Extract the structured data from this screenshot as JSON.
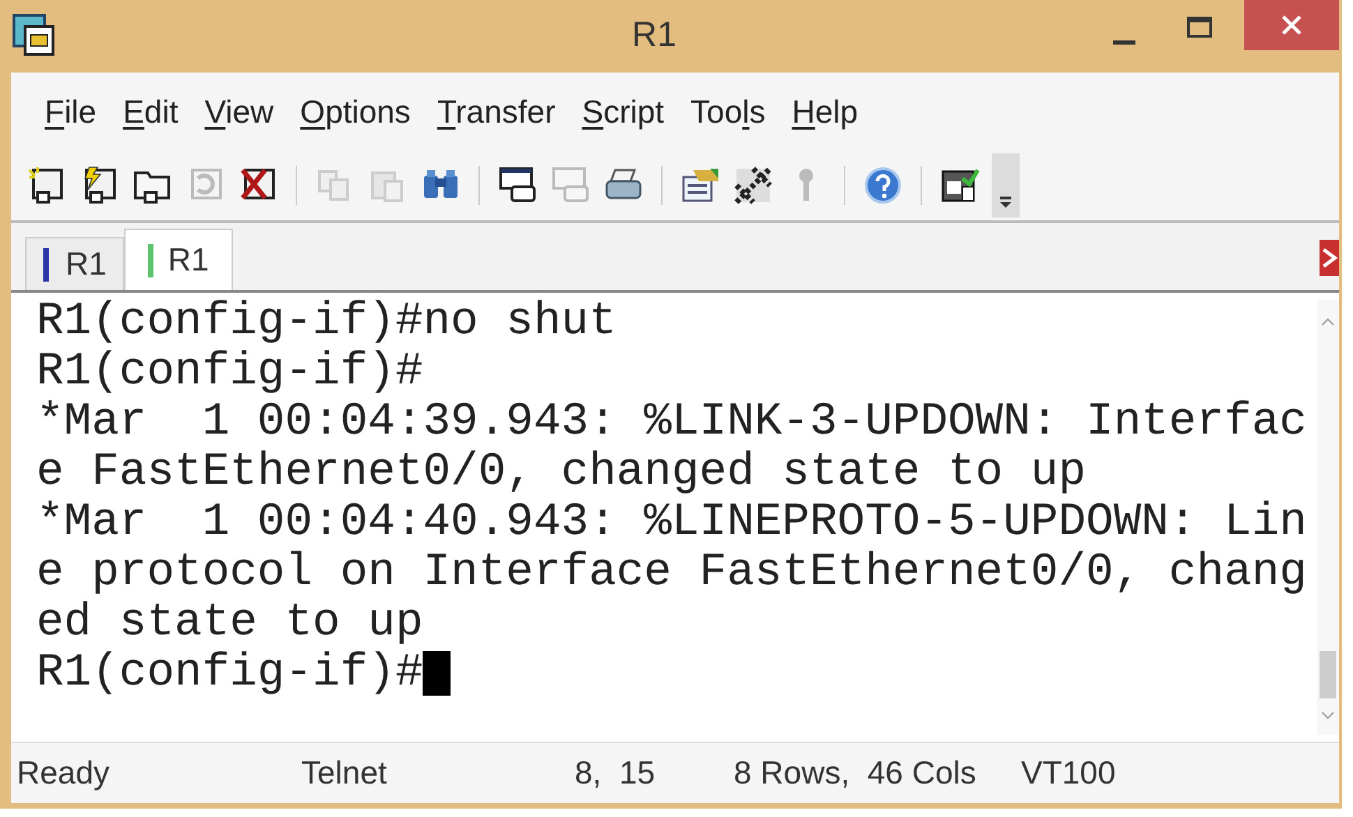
{
  "window": {
    "title": "R1"
  },
  "menu": [
    {
      "key": "F",
      "after": "ile"
    },
    {
      "key": "E",
      "after": "dit"
    },
    {
      "key": "V",
      "after": "iew"
    },
    {
      "key": "O",
      "after": "ptions"
    },
    {
      "key": "T",
      "after": "ransfer"
    },
    {
      "key": "S",
      "after": "cript"
    },
    {
      "before": "Too",
      "key": "l",
      "after": "s"
    },
    {
      "key": "H",
      "after": "elp"
    }
  ],
  "tabs": [
    {
      "label": "R1",
      "selected": false,
      "color": "#2a36a8"
    },
    {
      "label": "R1",
      "selected": true,
      "color": "#5cc46a"
    }
  ],
  "terminal": {
    "lines": [
      "R1(config-if)#no shut",
      "R1(config-if)#",
      "*Mar  1 00:04:39.943: %LINK-3-UPDOWN: Interfac",
      "e FastEthernet0/0, changed state to up",
      "*Mar  1 00:04:40.943: %LINEPROTO-5-UPDOWN: Lin",
      "e protocol on Interface FastEthernet0/0, chang",
      "ed state to up",
      "R1(config-if)#"
    ],
    "cursor": true
  },
  "status_bar": [
    "Ready",
    "Telnet",
    "8,  15",
    "8 Rows,  46 Cols",
    "VT100"
  ]
}
